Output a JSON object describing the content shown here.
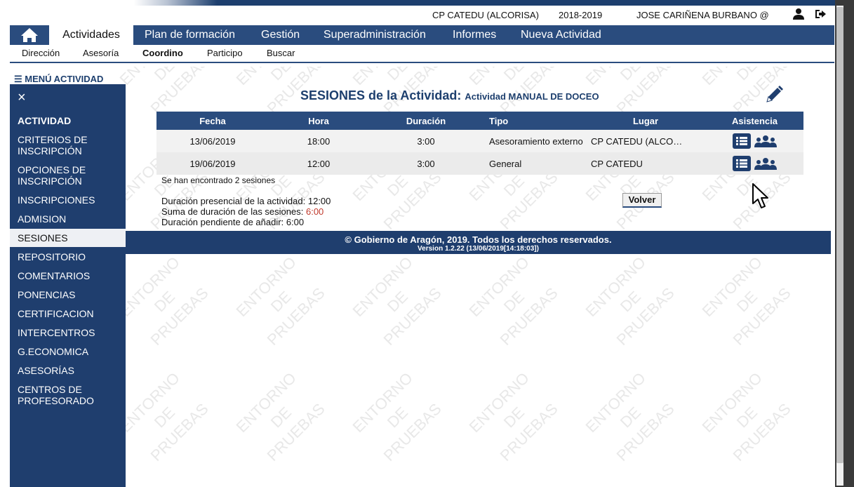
{
  "header": {
    "center": "CP CATEDU (ALCORISA)",
    "year": "2018-2019",
    "user": "JOSE CARIÑENA BURBANO @",
    "user_icon": "user-icon",
    "logout_icon": "logout-icon"
  },
  "nav": {
    "home_icon": "home-icon",
    "items": [
      "Actividades",
      "Plan de formación",
      "Gestión",
      "Superadministración",
      "Informes",
      "Nueva Actividad"
    ],
    "active": "Actividades"
  },
  "subnav": {
    "items": [
      "Dirección",
      "Asesoría",
      "Coordino",
      "Participo",
      "Buscar"
    ],
    "active": "Coordino"
  },
  "sidebar": {
    "menu_label": "☰ MENÚ ACTIVIDAD",
    "close": "×",
    "items": [
      "ACTIVIDAD",
      "CRITERIOS DE INSCRIPCIÓN",
      "OPCIONES DE INSCRIPCIÓN",
      "INSCRIPCIONES",
      "ADMISION",
      "SESIONES",
      "REPOSITORIO",
      "COMENTARIOS",
      "PONENCIAS",
      "CERTIFICACION",
      "INTERCENTROS",
      "G.ECONOMICA",
      "ASESORÍAS",
      "CENTROS DE PROFESORADO"
    ],
    "active": "SESIONES"
  },
  "main": {
    "title": "SESIONES de la Actividad:",
    "subtitle": "Actividad MANUAL DE DOCEO",
    "edit_icon": "pencil-icon",
    "table": {
      "headers": [
        "Fecha",
        "Hora",
        "Duración",
        "Tipo",
        "Lugar",
        "Asistencia"
      ],
      "rows": [
        [
          "13/06/2019",
          "18:00",
          "3:00",
          "Asesoramiento externo",
          "CP CATEDU (ALCO…"
        ],
        [
          "19/06/2019",
          "12:00",
          "3:00",
          "General",
          "CP CATEDU"
        ]
      ]
    },
    "found": "Se han encontrado 2 sesiones",
    "dur_presencial_label": "Duración presencial de la actividad:",
    "dur_presencial": "12:00",
    "suma_label": "Suma de duración de las sesiones:",
    "suma": "6:00",
    "pendiente_label": "Duración pendiente de añadir:",
    "pendiente": "6:00",
    "volver": "Volver"
  },
  "footer": {
    "line1": "© Gobierno de Aragón, 2019. Todos los derechos reservados.",
    "line2": "Version 1.2.22 (13/06/2019[14:18:03])"
  },
  "watermark": [
    "ENTORNO",
    "DE",
    "PRUEBAS"
  ],
  "colors": {
    "primary": "#1f3e6e",
    "nav": "#2a4c7e",
    "warning": "#c0392b"
  }
}
